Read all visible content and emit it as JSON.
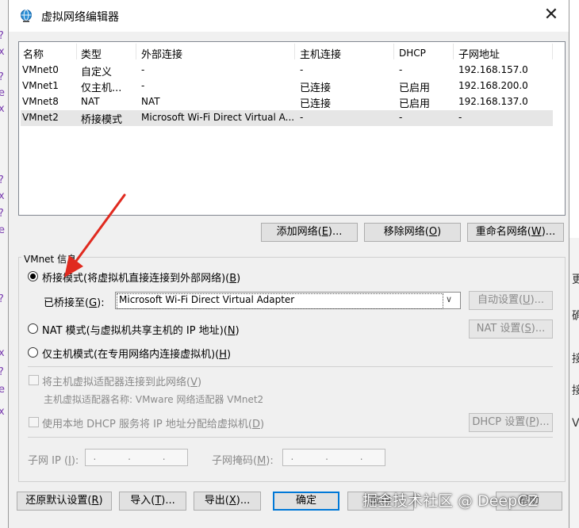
{
  "window": {
    "title": "虚拟网络编辑器",
    "close_glyph": "✕"
  },
  "list": {
    "headers": [
      "名称",
      "类型",
      "外部连接",
      "主机连接",
      "DHCP",
      "子网地址"
    ],
    "rows": [
      [
        "VMnet0",
        "自定义",
        "-",
        "-",
        "-",
        "192.168.157.0"
      ],
      [
        "VMnet1",
        "仅主机...",
        "-",
        "已连接",
        "已启用",
        "192.168.200.0"
      ],
      [
        "VMnet8",
        "NAT",
        "NAT",
        "已连接",
        "已启用",
        "192.168.137.0"
      ],
      [
        "VMnet2",
        "桥接模式",
        "Microsoft Wi-Fi Direct Virtual A...",
        "-",
        "-",
        "-"
      ]
    ],
    "selected_row": "VMnet2"
  },
  "list_buttons": {
    "add": {
      "text": "添加网络(",
      "key": "E",
      "tail": ")..."
    },
    "remove": {
      "text": "移除网络(",
      "key": "O",
      "tail": ")"
    },
    "rename": {
      "text": "重命名网络(",
      "key": "W",
      "tail": ")..."
    }
  },
  "info": {
    "group_title": "VMnet 信息",
    "bridge": {
      "text": "桥接模式(将虚拟机直接连接到外部网络)(",
      "key": "B",
      "tail": ")",
      "checked": true
    },
    "bridged_to": {
      "text": "已桥接至(",
      "key": "G",
      "tail": "):"
    },
    "adapter_value": "Microsoft Wi-Fi Direct Virtual Adapter",
    "auto_button": {
      "text": "自动设置(",
      "key": "U",
      "tail": ")..."
    },
    "nat": {
      "text": "NAT 模式(与虚拟机共享主机的 IP 地址)(",
      "key": "N",
      "tail": ")",
      "checked": false
    },
    "nat_button": {
      "text": "NAT 设置(",
      "key": "S",
      "tail": ")..."
    },
    "hostonly": {
      "text": "仅主机模式(在专用网络内连接虚拟机)(",
      "key": "H",
      "tail": ")",
      "checked": false
    },
    "connect_adapter": {
      "text": "将主机虚拟适配器连接到此网络(",
      "key": "V",
      "tail": ")",
      "checked": false
    },
    "adapter_name": "主机虚拟适配器名称: VMware 网络适配器 VMnet2",
    "use_dhcp": {
      "text": "使用本地 DHCP 服务将 IP 地址分配给虚拟机(",
      "key": "D",
      "tail": ")",
      "checked": false
    },
    "dhcp_button": {
      "text": "DHCP 设置(",
      "key": "P",
      "tail": ")..."
    },
    "subnet_ip": {
      "text": "子网 IP (",
      "key": "I",
      "tail": "):"
    },
    "subnet_mask": {
      "text": "子网掩码(",
      "key": "M",
      "tail": "):"
    },
    "ip_placeholder": ".     .     ."
  },
  "bottom_buttons": {
    "restore": {
      "text": "还原默认设置(",
      "key": "R",
      "tail": ")"
    },
    "import": {
      "text": "导入(",
      "key": "T",
      "tail": ")..."
    },
    "export": {
      "text": "导出(",
      "key": "X",
      "tail": ")..."
    },
    "ok": "确定",
    "apply_partial": "应用",
    "help_partial": "帮助"
  },
  "watermark": "掘金技术社区 @ DeepCZ",
  "background": {
    "left_chars": [
      "?",
      "x",
      "?",
      "e",
      "x",
      "?",
      "x",
      "?",
      "e",
      "?",
      "x",
      "?",
      "e",
      "x"
    ],
    "right_chars": [
      "更",
      "确",
      "接",
      "接",
      "V"
    ]
  },
  "colors": {
    "accent": "#0078d7",
    "arrow": "#e02a1f",
    "selection": "#e6e6e6"
  },
  "icons": {
    "title": "network-globe-icon",
    "dropdown": "chevron-down-icon",
    "arrow": "red-arrow-annotation"
  }
}
